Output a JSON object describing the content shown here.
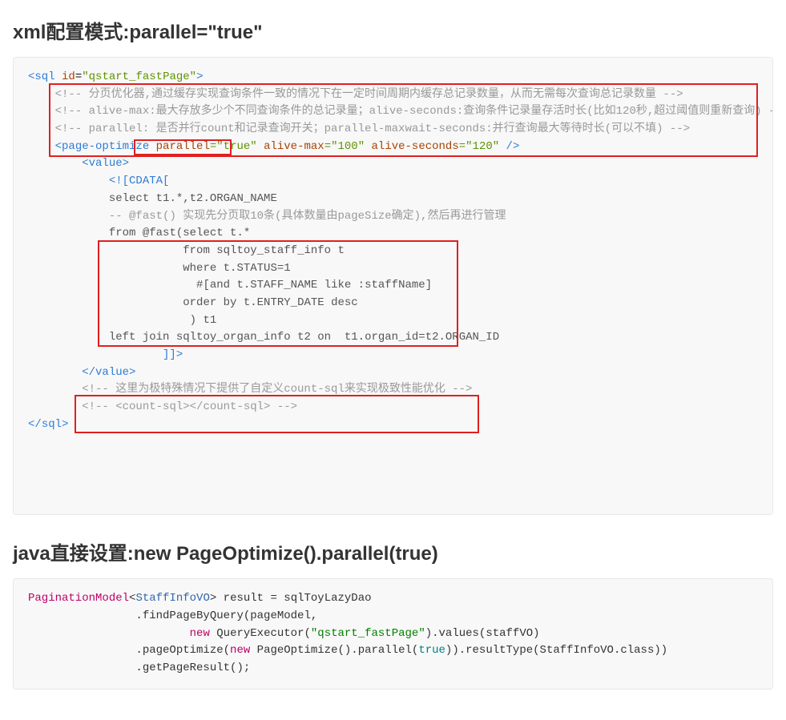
{
  "heading1": "xml配置模式:parallel=\"true\"",
  "heading2": "java直接设置:new PageOptimize().parallel(true)",
  "xml": {
    "sql_open_lt": "<",
    "sql_open_tag": "sql",
    "sql_id_attr": " id",
    "sql_eq": "=",
    "sql_id_val": "\"qstart_fastPage\"",
    "sql_close": ">",
    "cmt1_open": "<!--",
    "cmt1_body": " 分页优化器,通过缓存实现查询条件一致的情况下在一定时间周期内缓存总记录数量，从而无需每次查询总记录数量 ",
    "cmt1_close": "-->",
    "cmt2_open": "<!--",
    "cmt2_body": " alive-max:最大存放多少个不同查询条件的总记录量；alive-seconds:查询条件记录量存活时长(比如120秒,超过阈值则重新查询) ",
    "cmt2_close": "-->",
    "cmt3_open": "<!--",
    "cmt3_body": " parallel: 是否并行count和记录查询开关；parallel-maxwait-seconds:并行查询最大等待时长(可以不填) ",
    "cmt3_close": "-->",
    "po_lt": "<",
    "po_tag": "page-optimize",
    "po_a1": " parallel",
    "po_v1": "=\"true\"",
    "po_a2": " alive-max",
    "po_v2": "=\"100\"",
    "po_a3": " alive-seconds",
    "po_v3": "=\"120\"",
    "po_end": " />",
    "value_open_lt": "<",
    "value_open_tag": "value",
    "value_open_gt": ">",
    "cdata_open": "<![CDATA[",
    "sql_line1": "select t1.*,t2.ORGAN_NAME",
    "sql_cmt_fast": "-- @fast() 实现先分页取10条(具体数量由pageSize确定),然后再进行管理",
    "sql_line2": "from @fast(select t.*",
    "sql_line3": "           from sqltoy_staff_info t",
    "sql_line4": "           where t.STATUS=1",
    "sql_line5": "             #[and t.STAFF_NAME like :staffName]",
    "sql_line6": "           order by t.ENTRY_DATE desc",
    "sql_line7": "            ) t1",
    "sql_line8": "left join sqltoy_organ_info t2 on  t1.organ_id=t2.ORGAN_ID",
    "cdata_close": "]]>",
    "value_close_lt": "</",
    "value_close_tag": "value",
    "value_close_gt": ">",
    "cmt4_open": "<!--",
    "cmt4_body": " 这里为极特殊情况下提供了自定义count-sql来实现极致性能优化 ",
    "cmt4_close": "-->",
    "cmt5_open": "<!--",
    "cmt5_body": " <count-sql></count-sql> ",
    "cmt5_close": "-->",
    "sql_end_lt": "</",
    "sql_end_tag": "sql",
    "sql_end_gt": ">"
  },
  "java": {
    "l1_cls": "PaginationModel",
    "l1_lt": "<",
    "l1_gp": "StaffInfoVO",
    "l1_gt": ">",
    "l1_var": " result ",
    "l1_eq": "=",
    "l1_dao": " sqlToyLazyDao",
    "l2": "                .findPageByQuery(pageModel,",
    "l3_pad": "                        ",
    "l3_new": "new",
    "l3_qe": " QueryExecutor(",
    "l3_str": "\"qstart_fastPage\"",
    "l3_rest": ").values(staffVO)",
    "l4_pad": "                .pageOptimize(",
    "l4_new": "new",
    "l4_po": " PageOptimize().parallel(",
    "l4_true": "true",
    "l4_rest": ")).resultType(StaffInfoVO.class))",
    "l5": "                .getPageResult();"
  }
}
